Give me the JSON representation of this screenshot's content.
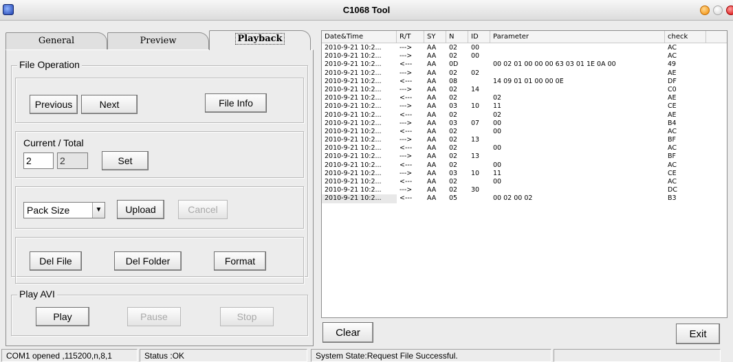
{
  "window": {
    "title": "C1068 Tool"
  },
  "tabs": [
    {
      "label": "General"
    },
    {
      "label": "Preview"
    },
    {
      "label": "Playback"
    }
  ],
  "file_operation": {
    "legend": "File Operation",
    "previous": "Previous",
    "next": "Next",
    "file_info": "File Info"
  },
  "current_total": {
    "label": "Current / Total",
    "current": "2",
    "total": "2",
    "set": "Set"
  },
  "upload": {
    "pack_size": "Pack Size",
    "upload": "Upload",
    "cancel": "Cancel"
  },
  "delete": {
    "del_file": "Del File",
    "del_folder": "Del Folder",
    "format": "Format"
  },
  "play_avi": {
    "legend": "Play AVI",
    "play": "Play",
    "pause": "Pause",
    "stop": "Stop"
  },
  "log": {
    "columns": [
      "Date&Time",
      "R/T",
      "SY",
      "N",
      "ID",
      "Parameter",
      "check"
    ],
    "rows": [
      [
        "2010-9-21 10:2...",
        "--->",
        "AA",
        "02",
        "00",
        "",
        "AC"
      ],
      [
        "2010-9-21 10:2...",
        "--->",
        "AA",
        "02",
        "00",
        "",
        "AC"
      ],
      [
        "2010-9-21 10:2...",
        "<---",
        "AA",
        "0D",
        "",
        "00 02 01 00 00 00 63 03 01 1E 0A 00",
        "49"
      ],
      [
        "2010-9-21 10:2...",
        "--->",
        "AA",
        "02",
        "02",
        "",
        "AE"
      ],
      [
        "2010-9-21 10:2...",
        "<---",
        "AA",
        "08",
        "",
        "14 09 01 01 00 00 0E",
        "DF"
      ],
      [
        "2010-9-21 10:2...",
        "--->",
        "AA",
        "02",
        "14",
        "",
        "C0"
      ],
      [
        "2010-9-21 10:2...",
        "<---",
        "AA",
        "02",
        "",
        "02",
        "AE"
      ],
      [
        "2010-9-21 10:2...",
        "--->",
        "AA",
        "03",
        "10",
        "11",
        "CE"
      ],
      [
        "2010-9-21 10:2...",
        "<---",
        "AA",
        "02",
        "",
        "02",
        "AE"
      ],
      [
        "2010-9-21 10:2...",
        "--->",
        "AA",
        "03",
        "07",
        "00",
        "B4"
      ],
      [
        "2010-9-21 10:2...",
        "<---",
        "AA",
        "02",
        "",
        "00",
        "AC"
      ],
      [
        "2010-9-21 10:2...",
        "--->",
        "AA",
        "02",
        "13",
        "",
        "BF"
      ],
      [
        "2010-9-21 10:2...",
        "<---",
        "AA",
        "02",
        "",
        "00",
        "AC"
      ],
      [
        "2010-9-21 10:2...",
        "--->",
        "AA",
        "02",
        "13",
        "",
        "BF"
      ],
      [
        "2010-9-21 10:2...",
        "<---",
        "AA",
        "02",
        "",
        "00",
        "AC"
      ],
      [
        "2010-9-21 10:2...",
        "--->",
        "AA",
        "03",
        "10",
        "11",
        "CE"
      ],
      [
        "2010-9-21 10:2...",
        "<---",
        "AA",
        "02",
        "",
        "00",
        "AC"
      ],
      [
        "2010-9-21 10:2...",
        "--->",
        "AA",
        "02",
        "30",
        "",
        "DC"
      ],
      [
        "2010-9-21 10:2...",
        "<---",
        "AA",
        "05",
        "",
        "00 02 00 02",
        "B3"
      ]
    ]
  },
  "buttons": {
    "clear": "Clear",
    "exit": "Exit"
  },
  "status": {
    "port": "COM1 opened ,115200,n,8,1",
    "state": "Status :OK",
    "system": "System State:Request File Successful.",
    "extra": ""
  },
  "icons": {
    "app": "app-icon",
    "minimize": "minimize-icon",
    "maximize": "maximize-icon",
    "close": "close-icon",
    "dropdown": "chevron-down-icon"
  }
}
